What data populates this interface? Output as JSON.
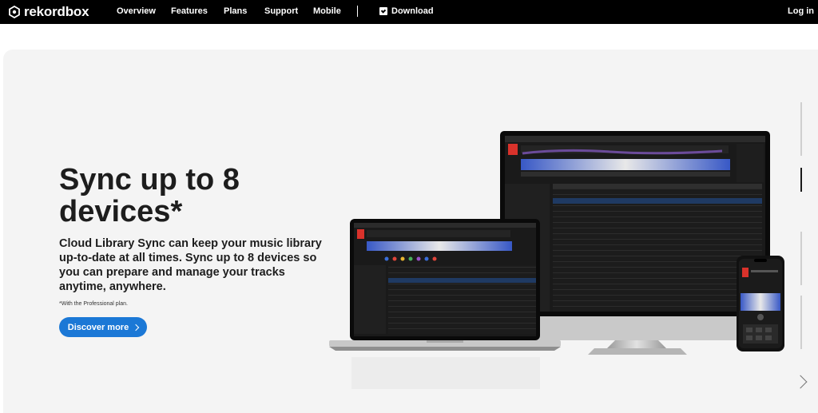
{
  "nav": {
    "brand": "rekordbox",
    "items": [
      "Overview",
      "Features",
      "Plans",
      "Support",
      "Mobile"
    ],
    "download_label": "Download",
    "login_label": "Log in"
  },
  "hero": {
    "headline": "Sync up to 8 devices*",
    "subtext": "Cloud Library Sync can keep your music library up-to-date at all times. Sync up to 8 devices so you can prepare and manage your tracks anytime, anywhere.",
    "footnote": "*With the Professional plan.",
    "cta_label": "Discover more"
  },
  "colors": {
    "nav_bg": "#000000",
    "hero_bg": "#f4f4f4",
    "cta": "#1b78d6",
    "brand_red": "#d9322b"
  }
}
